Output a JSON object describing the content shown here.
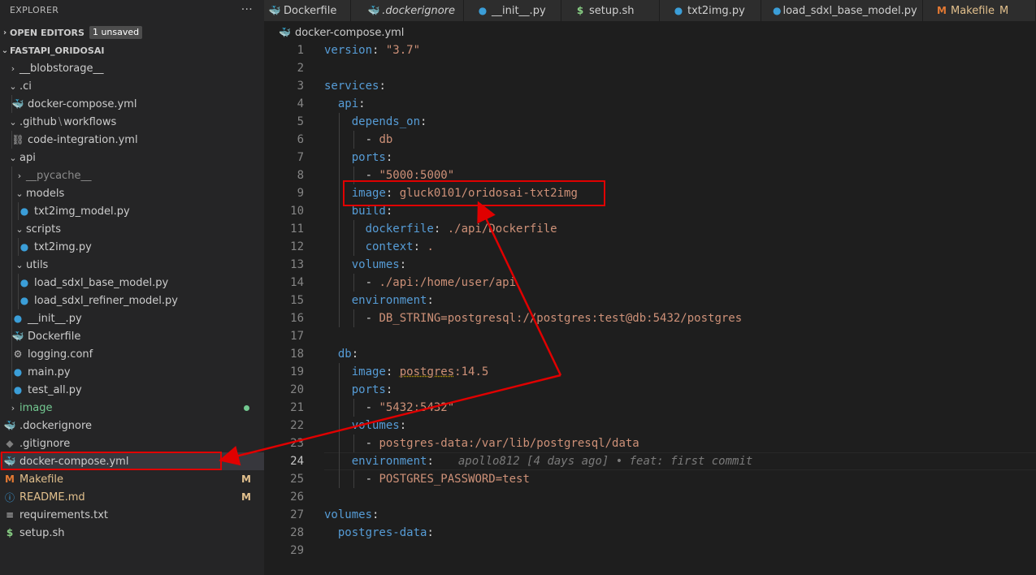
{
  "explorer": {
    "title": "EXPLORER",
    "more_label": "···",
    "open_editors": {
      "label": "OPEN EDITORS",
      "badge": "1 unsaved"
    },
    "project": {
      "label": "FASTAPI_ORIDOSAI"
    },
    "items": [
      {
        "label": "__blobstorage__"
      },
      {
        "label": ".ci"
      },
      {
        "label": "docker-compose.yml"
      },
      {
        "label": ".github",
        "sep": "\\",
        "label2": "workflows"
      },
      {
        "label": "code-integration.yml"
      },
      {
        "label": "api"
      },
      {
        "label": "__pycache__"
      },
      {
        "label": "models"
      },
      {
        "label": "txt2img_model.py"
      },
      {
        "label": "scripts"
      },
      {
        "label": "txt2img.py"
      },
      {
        "label": "utils"
      },
      {
        "label": "load_sdxl_base_model.py"
      },
      {
        "label": "load_sdxl_refiner_model.py"
      },
      {
        "label": "__init__.py"
      },
      {
        "label": "Dockerfile"
      },
      {
        "label": "logging.conf"
      },
      {
        "label": "main.py"
      },
      {
        "label": "test_all.py"
      },
      {
        "label": "image"
      },
      {
        "label": ".dockerignore"
      },
      {
        "label": ".gitignore"
      },
      {
        "label": "docker-compose.yml"
      },
      {
        "label": "Makefile",
        "badge": "M"
      },
      {
        "label": "README.md",
        "badge": "M"
      },
      {
        "label": "requirements.txt"
      },
      {
        "label": "setup.sh"
      }
    ]
  },
  "tabs": [
    {
      "label": "Dockerfile",
      "icon": "docker-icon"
    },
    {
      "label": ".dockerignore",
      "icon": "docker-icon"
    },
    {
      "label": "__init__.py",
      "icon": "python-icon"
    },
    {
      "label": "setup.sh",
      "icon": "shell-icon"
    },
    {
      "label": "txt2img.py",
      "icon": "python-icon"
    },
    {
      "label": "load_sdxl_base_model.py",
      "icon": "python-icon"
    },
    {
      "label": "Makefile",
      "icon": "makefile-icon",
      "badge": "M"
    }
  ],
  "breadcrumb": {
    "file": "docker-compose.yml"
  },
  "editor": {
    "current_line": 24,
    "lines": [
      {
        "n": "1"
      },
      {
        "n": "2"
      },
      {
        "n": "3"
      },
      {
        "n": "4"
      },
      {
        "n": "5"
      },
      {
        "n": "6"
      },
      {
        "n": "7"
      },
      {
        "n": "8"
      },
      {
        "n": "9"
      },
      {
        "n": "10"
      },
      {
        "n": "11"
      },
      {
        "n": "12"
      },
      {
        "n": "13"
      },
      {
        "n": "14"
      },
      {
        "n": "15"
      },
      {
        "n": "16"
      },
      {
        "n": "17"
      },
      {
        "n": "18"
      },
      {
        "n": "19"
      },
      {
        "n": "20"
      },
      {
        "n": "21"
      },
      {
        "n": "22"
      },
      {
        "n": "23"
      },
      {
        "n": "24"
      },
      {
        "n": "25"
      },
      {
        "n": "26"
      },
      {
        "n": "27"
      },
      {
        "n": "28"
      },
      {
        "n": "29"
      }
    ],
    "tok": {
      "version_key": "version",
      "version_val": "\"3.7\"",
      "services_key": "services",
      "api_key": "api",
      "depends_on_key": "depends_on",
      "db_item": "db",
      "ports_key": "ports",
      "port_api": "\"5000:5000\"",
      "image_key": "image",
      "image_api": "gluck0101/oridosai-txt2img",
      "build_key": "build",
      "dockerfile_key": "dockerfile",
      "dockerfile_val": "./api/Dockerfile",
      "context_key": "context",
      "context_val": ".",
      "volumes_key": "volumes",
      "vol_api": "./api:/home/user/api",
      "environment_key": "environment",
      "env_api": "DB_STRING=postgresql://postgres:test@db:5432/postgres",
      "db_key": "db",
      "image_db_a": "postgres",
      "image_db_b": ":14.5",
      "port_db": "\"5432:5432\"",
      "vol_db": "postgres-data:/var/lib/postgresql/data",
      "blame": "apollo812 [4 days ago] • feat: first commit",
      "env_db": "POSTGRES_PASSWORD=test",
      "postgres_data_key": "postgres-data"
    }
  },
  "colors": {
    "annotation_red": "#e00000",
    "modified_yellow": "#e2c08d",
    "untracked_green": "#73c991"
  }
}
